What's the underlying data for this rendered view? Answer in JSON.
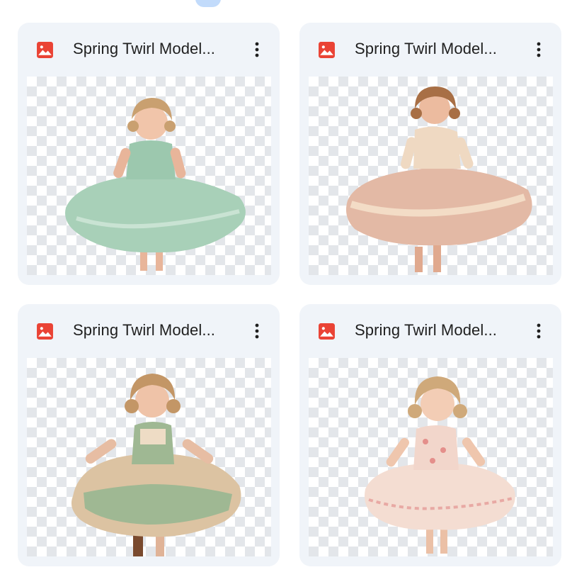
{
  "cards": [
    {
      "title": "Spring Twirl Model...",
      "icon": "image-file-icon",
      "menu_icon": "more-vert-icon",
      "image": "girl twirling in mint floral dress on transparent background"
    },
    {
      "title": "Spring Twirl Model...",
      "icon": "image-file-icon",
      "menu_icon": "more-vert-icon",
      "image": "girl twirling in cream and pink floral dress on transparent background"
    },
    {
      "title": "Spring Twirl Model...",
      "icon": "image-file-icon",
      "menu_icon": "more-vert-icon",
      "image": "girl twirling in sage green pinafore dress on transparent background"
    },
    {
      "title": "Spring Twirl Model...",
      "icon": "image-file-icon",
      "menu_icon": "more-vert-icon",
      "image": "girl twirling in pink rose print dress on transparent background"
    }
  ],
  "colors": {
    "card_background": "#f0f4f9",
    "image_icon": "#ea4335",
    "title_text": "#1f1f1f",
    "checker": "#e3e6ea"
  }
}
